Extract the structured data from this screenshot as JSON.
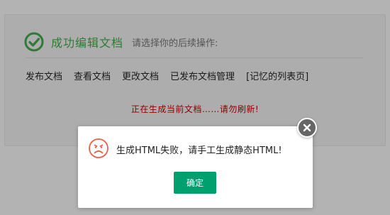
{
  "background": {
    "success_title": "成功编辑文档",
    "success_hint": "请选择你的后续操作:",
    "links": [
      {
        "label": "发布文档"
      },
      {
        "label": "查看文档"
      },
      {
        "label": "更改文档"
      },
      {
        "label": "已发布文档管理"
      },
      {
        "label": "[记忆的列表页]"
      }
    ],
    "processing_text": "正在生成当前文档……请勿刷新!"
  },
  "dialog": {
    "message": "生成HTML失败，请手工生成静态HTML!",
    "confirm_label": "确定",
    "icon": "sad-face-icon",
    "close_icon": "close-icon"
  },
  "colors": {
    "overlay": "#b3b3b3",
    "success_green": "#2f7a37",
    "processing_red": "#8b0000",
    "confirm_green": "#009f6e",
    "sad_face_red": "#e8624a"
  }
}
